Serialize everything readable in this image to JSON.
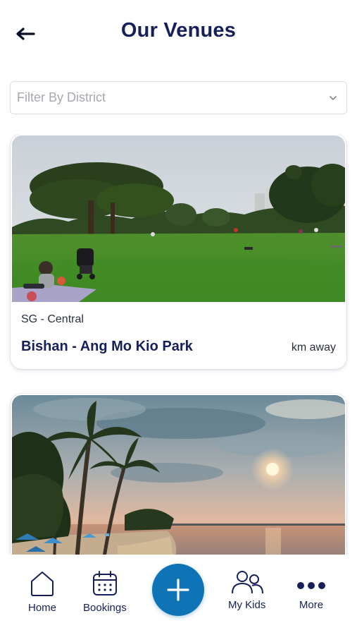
{
  "header": {
    "title": "Our Venues",
    "back_icon": "arrow-left-icon"
  },
  "filter": {
    "placeholder": "Filter By District",
    "icon": "chevron-down-icon"
  },
  "venues": [
    {
      "district": "SG - Central",
      "name": "Bishan - Ang Mo Kio Park",
      "distance": "km away",
      "image": "park-lawn-photo"
    },
    {
      "district": "",
      "name": "",
      "distance": "",
      "image": "beach-sunset-photo"
    }
  ],
  "tabs": [
    {
      "label": "Home",
      "icon": "home-icon"
    },
    {
      "label": "Bookings",
      "icon": "calendar-icon"
    },
    {
      "label": "My Kids",
      "icon": "users-icon"
    },
    {
      "label": "More",
      "icon": "more-dots-icon"
    }
  ],
  "fab": {
    "icon": "plus-icon"
  },
  "colors": {
    "primary": "#15205a",
    "accent": "#0f74b5",
    "placeholder": "#a6a8b0",
    "border": "#dcdde3"
  }
}
